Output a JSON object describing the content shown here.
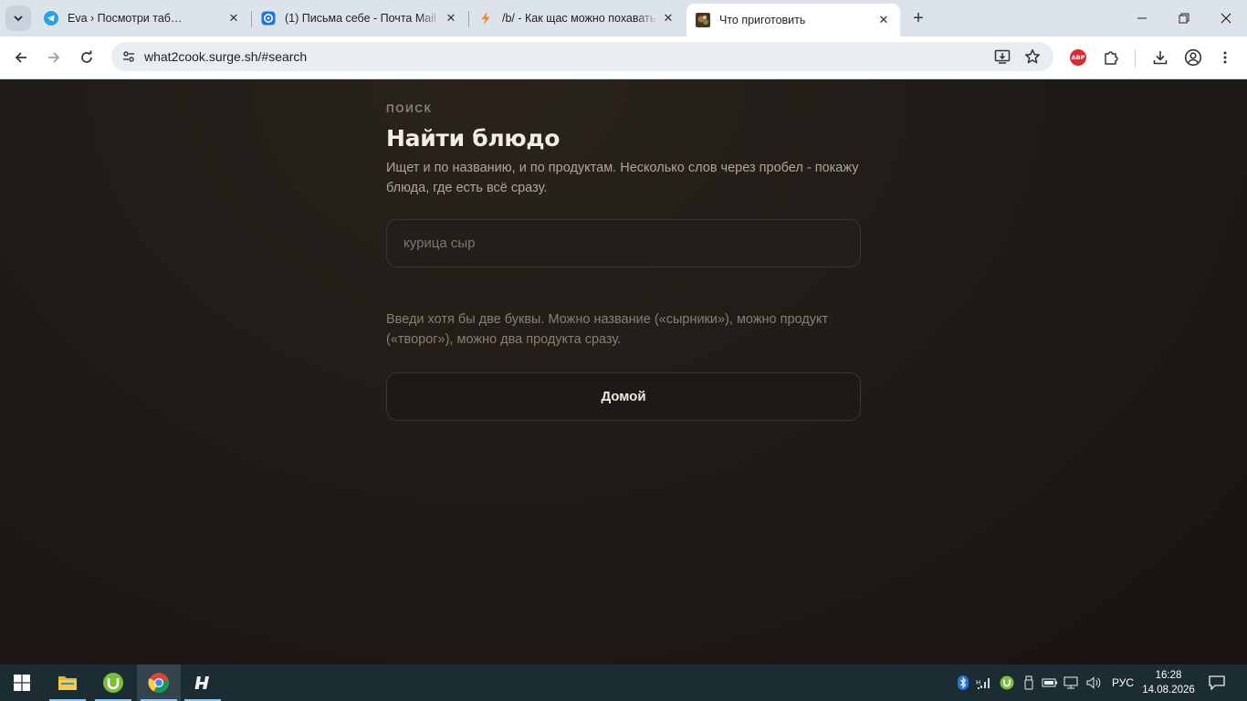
{
  "browser": {
    "tabs": [
      {
        "title": "Eva › Посмотри таб…",
        "favicon": "telegram-icon",
        "active": false
      },
      {
        "title": "(1) Письма себе - Почта Mail",
        "favicon": "mail-icon",
        "active": false
      },
      {
        "title": "/b/ - Как щас можно похавать",
        "favicon": "lightning-icon",
        "active": false
      },
      {
        "title": "Что приготовить",
        "favicon": "food-photo-icon",
        "active": true
      }
    ],
    "url": "what2cook.surge.sh/#search"
  },
  "page": {
    "eyebrow": "ПОИСК",
    "title": "Найти блюдо",
    "lead": "Ищет и по названию, и по продуктам. Несколько слов через пробел - покажу блюда, где есть всё сразу.",
    "search": {
      "placeholder": "курица сыр",
      "value": ""
    },
    "hint": "Введи хотя бы две буквы. Можно название («сырники»), можно продукт («творог»), можно два продукта сразу.",
    "home_button": "Домой"
  },
  "taskbar": {
    "apps": [
      "file-explorer-icon",
      "utorrent-icon",
      "chrome-icon",
      "app-h-icon"
    ],
    "language": "РУС",
    "time": "16:28",
    "date": "14.08.2026"
  },
  "colors": {
    "page_bg": "#1f1b17",
    "title": "#f4ede2",
    "muted": "#b1a695",
    "border": "#3b3530",
    "taskbar": "#1c2c33"
  }
}
